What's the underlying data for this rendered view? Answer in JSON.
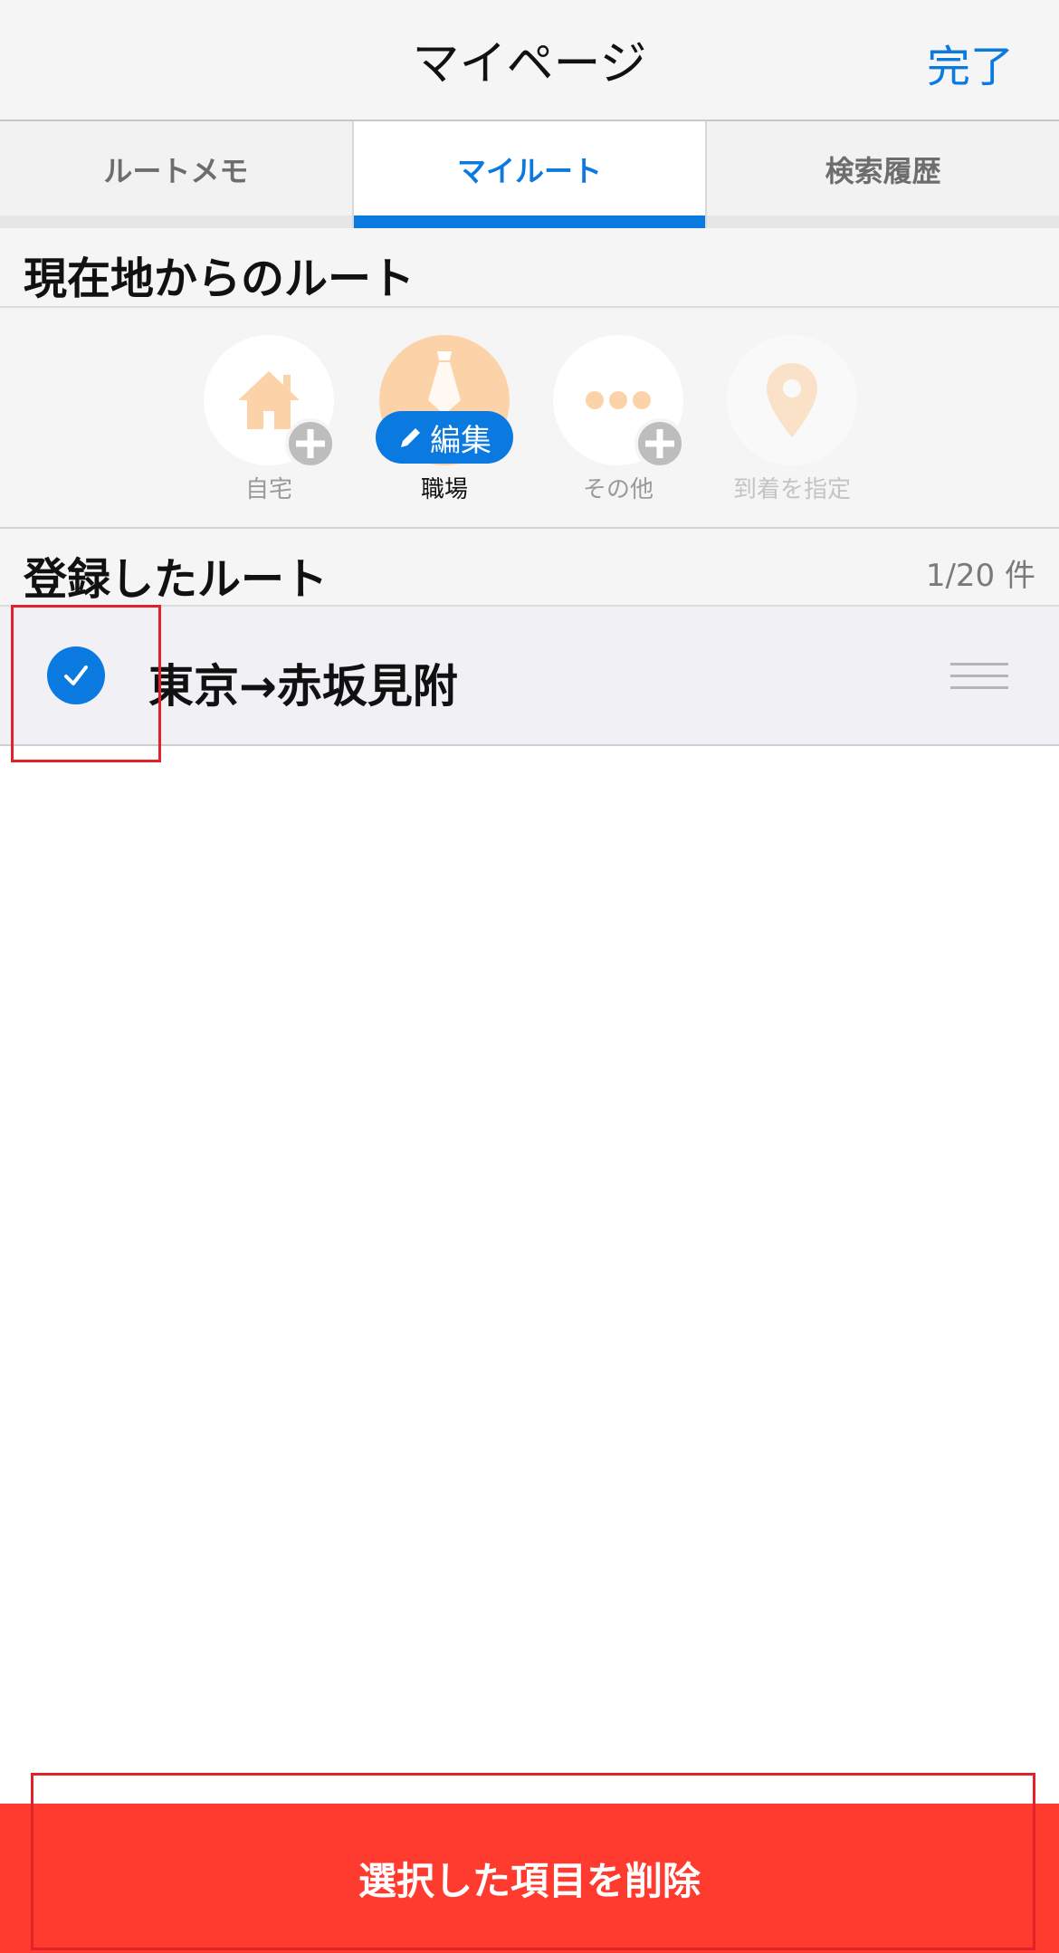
{
  "header": {
    "title": "マイページ",
    "done_label": "完了"
  },
  "tabs": [
    {
      "label": "ルートメモ",
      "active": false
    },
    {
      "label": "マイルート",
      "active": true
    },
    {
      "label": "検索履歴",
      "active": false
    }
  ],
  "current_location": {
    "title": "現在地からのルート",
    "shortcuts": [
      {
        "label": "自宅",
        "icon": "house-icon",
        "badge": "plus"
      },
      {
        "label": "職場",
        "icon": "necktie-icon",
        "badge_label": "編集"
      },
      {
        "label": "その他",
        "icon": "more-dots-icon",
        "badge": "plus"
      },
      {
        "label": "到着を指定",
        "icon": "map-pin-icon"
      }
    ]
  },
  "registered_routes": {
    "title": "登録したルート",
    "count": "1/20 件",
    "items": [
      {
        "name": "東京→赤坂見附",
        "selected": true
      }
    ]
  },
  "footer": {
    "delete_label": "選択した項目を削除"
  },
  "colors": {
    "accent": "#0a7ae0",
    "danger": "#ff3b30",
    "shortcut_icon": "#fcd3a8",
    "highlight": "#e0222a"
  }
}
